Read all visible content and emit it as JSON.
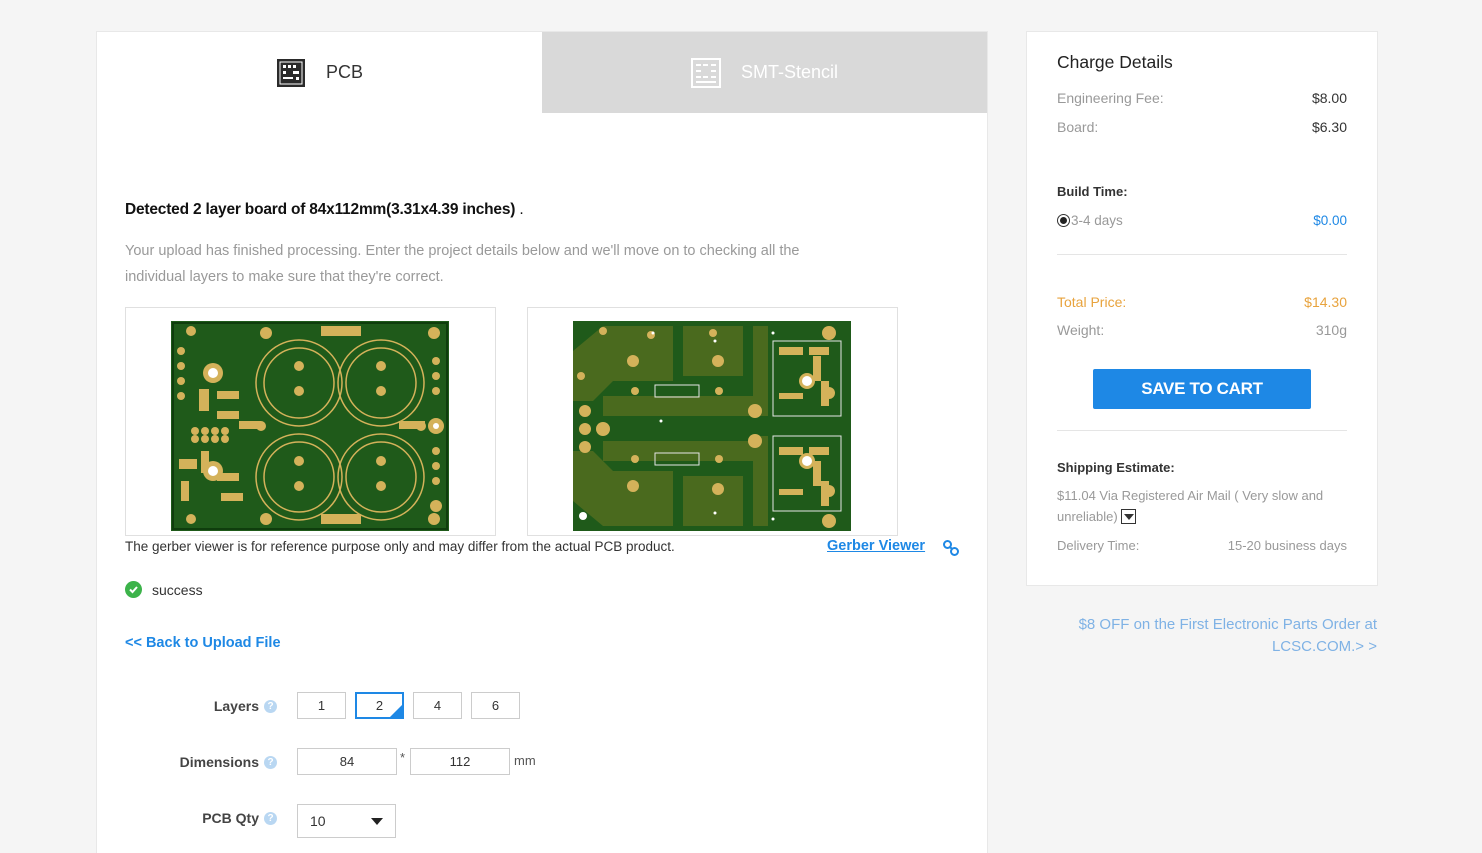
{
  "tabs": {
    "pcb_label": "PCB",
    "smt_label": "SMT-Stencil"
  },
  "main": {
    "detected_text": "Detected 2 layer board of 84x112mm(3.31x4.39 inches)",
    "detected_dot": " .",
    "description": "Your upload has finished processing. Enter the project details below and we'll move on to checking all the individual layers to make sure that they're correct.",
    "reference_note": "The gerber viewer is for reference purpose only and may differ from the actual PCB product.",
    "gerber_viewer_label": "Gerber Viewer",
    "status": "success",
    "back_label": "<< Back to Upload File"
  },
  "form": {
    "layers_label": "Layers",
    "layers_options": [
      "1",
      "2",
      "4",
      "6"
    ],
    "layers_selected": "2",
    "dimensions_label": "Dimensions",
    "width": "84",
    "height": "112",
    "times_symbol": "*",
    "unit": "mm",
    "qty_label": "PCB Qty",
    "qty_value": "10"
  },
  "charge": {
    "title": "Charge Details",
    "engineering_fee_label": "Engineering Fee:",
    "engineering_fee_value": "$8.00",
    "board_label": "Board:",
    "board_value": "$6.30",
    "build_time_label": "Build Time:",
    "build_option_label": "3-4 days",
    "build_option_price": "$0.00",
    "total_label": "Total Price:",
    "total_value": "$14.30",
    "weight_label": "Weight:",
    "weight_value": "310g",
    "save_button": "SAVE TO CART",
    "shipping_title": "Shipping Estimate:",
    "shipping_text": "$11.04 Via  Registered Air Mail ( Very slow and unreliable)",
    "delivery_label": "Delivery Time:",
    "delivery_value": "15-20 business days"
  },
  "promo": "$8 OFF on the First Electronic Parts Order at LCSC.COM.> >",
  "colors": {
    "accent": "#1e88e5",
    "total": "#e8a33d",
    "success": "#3cb34a",
    "pcb_green": "#1f5a1a",
    "pcb_gold": "#d4b25a"
  }
}
